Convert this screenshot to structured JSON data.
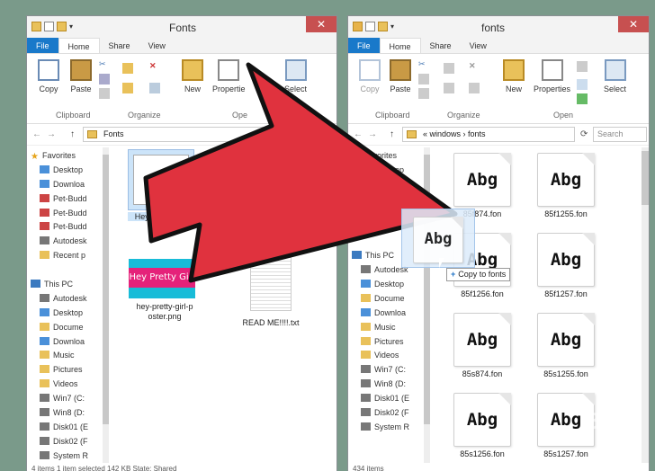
{
  "left_window": {
    "title": "Fonts",
    "close_glyph": "✕",
    "tabs": [
      "File",
      "Home",
      "Share",
      "View"
    ],
    "ribbon": {
      "copy": "Copy",
      "paste": "Paste",
      "new": "New",
      "properties": "Propertie",
      "select": "Select",
      "groups": [
        "Clipboard",
        "Organize",
        "Ope"
      ]
    },
    "nav_back": "←",
    "nav_fwd": "→",
    "nav_up": "↑",
    "address": "Fonts",
    "nav_items": [
      "Favorites",
      "Desktop",
      "Downloa",
      "Pet-Budd",
      "Pet-Budd",
      "Pet-Budd",
      "Autodesk",
      "Recent p",
      "",
      "This PC",
      "Autodesk",
      "Desktop",
      "Docume",
      "Downloa",
      "Music",
      "Pictures",
      "Videos",
      "Win7 (C:",
      "Win8 (D:",
      "Disk01 (E",
      "Disk02 (F",
      "System R"
    ],
    "files": [
      {
        "name": "Hey Pretty Girl.ttf"
      },
      {
        "name": "hey-pretty-girl-p\noster.png",
        "thumb_text": "Hey Pretty Girl"
      },
      {
        "name": "READ ME!!!!.txt"
      }
    ],
    "status": "4 items     1 item selected  142 KB      State:  Shared"
  },
  "right_window": {
    "title": "fonts",
    "close_glyph": "✕",
    "tabs": [
      "File",
      "Home",
      "Share",
      "View"
    ],
    "ribbon": {
      "copy": "Copy",
      "paste": "Paste",
      "new": "New",
      "properties": "Properties",
      "select": "Select",
      "groups": [
        "Clipboard",
        "Organize",
        "Open"
      ]
    },
    "nav_back": "←",
    "nav_fwd": "→",
    "nav_up": "↑",
    "address": "«  windows  ›  fonts",
    "refresh": "⟳",
    "search_placeholder": "Search",
    "nav_items": [
      "Favorites",
      "Desktop",
      "Downloa",
      "",
      "Autode",
      "Recent",
      "",
      "This PC",
      "Autodesk",
      "Desktop",
      "Docume",
      "Downloa",
      "Music",
      "Pictures",
      "Videos",
      "Win7 (C:",
      "Win8 (D:",
      "Disk01 (E",
      "Disk02 (F",
      "System R"
    ],
    "font_files": [
      "85f874.fon",
      "85f1255.fon",
      "85f1256.fon",
      "85f1257.fon",
      "85s874.fon",
      "85s1255.fon",
      "85s1256.fon",
      "85s1257.fon"
    ],
    "font_sample": "Abg",
    "status": "434 items"
  },
  "drag": {
    "sample": "Abg",
    "tooltip": "Copy to fonts",
    "tooltip_icon": "+"
  },
  "watermark": "Bai",
  "colors": {
    "file_tab": "#1979ca",
    "arrow_fill": "#e0323e",
    "close": "#c75050"
  }
}
